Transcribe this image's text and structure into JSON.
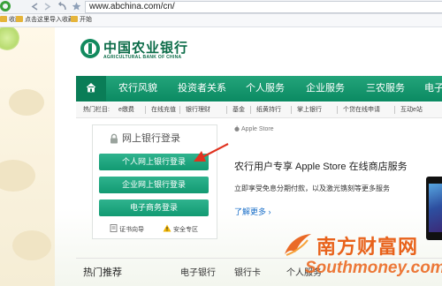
{
  "browser": {
    "back_icon": "arrow-left-icon",
    "forward_icon": "arrow-right-icon",
    "undo_icon": "back-curve-icon",
    "star_icon": "star-icon",
    "address": "www.abchina.com/cn/",
    "favorites": [
      {
        "label": "收藏",
        "icon": "star-icon",
        "color": "#e5b43a"
      },
      {
        "label": "点击这里导入收藏",
        "icon": "folder-icon",
        "color": "#e5b43a"
      },
      {
        "label": "开始",
        "icon": "page-icon",
        "color": "#e5b43a"
      }
    ]
  },
  "header": {
    "logo_cn": "中国农业银行",
    "logo_en": "AGRICULTURAL BANK OF CHINA",
    "brand_color": "#0b8a62"
  },
  "nav": {
    "home_icon": "home-icon",
    "items": [
      "农行风貌",
      "投资者关系",
      "个人服务",
      "企业服务",
      "三农服务",
      "电子"
    ]
  },
  "hotbar": {
    "label": "热门栏目:",
    "items": [
      "e缴费",
      "在线充值",
      "银行理财",
      "基金",
      "纸黄持行",
      "掌上银行",
      "个贷在线申请",
      "互动e站"
    ]
  },
  "login": {
    "lock_icon": "lock-icon",
    "title": "网上银行登录",
    "buttons": [
      "个人网上银行登录",
      "企业网上银行登录",
      "电子商务登录"
    ],
    "cert_icon": "certificate-icon",
    "cert_label": "证书向导",
    "warning_icon": "warning-icon",
    "safety_label": "安全专区"
  },
  "apple_store": {
    "breadcrumb": "Apple Store",
    "title": "农行用户专享 Apple Store 在线商店服务",
    "description": "立即享受免息分期付款，以及激光镌刻等更多服务",
    "more_link": "了解更多 ›"
  },
  "bottom": {
    "title": "热门推荐",
    "items": [
      "电子银行",
      "银行卡",
      "个人服务"
    ]
  },
  "watermark": {
    "text_cn": "南方财富网",
    "text_en": "Southmoney.com",
    "color": "#e85a10"
  },
  "annotation": {
    "arrow_color": "#e0321f"
  }
}
